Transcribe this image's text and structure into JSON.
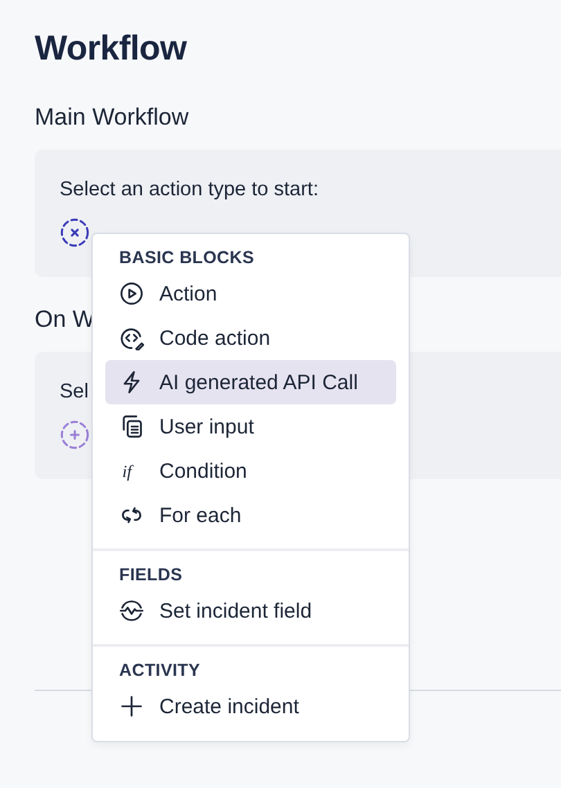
{
  "title": "Workflow",
  "sections": [
    {
      "heading": "Main Workflow",
      "prompt": "Select an action type to start:",
      "picker_open": true
    },
    {
      "heading": "On W",
      "prompt": "Sel",
      "picker_open": false
    }
  ],
  "menu": {
    "groups": [
      {
        "heading": "BASIC BLOCKS",
        "items": [
          {
            "kind": "action",
            "label": "Action",
            "selected": false
          },
          {
            "kind": "code",
            "label": "Code action",
            "selected": false
          },
          {
            "kind": "ai",
            "label": "AI generated API Call",
            "selected": true
          },
          {
            "kind": "input",
            "label": "User input",
            "selected": false
          },
          {
            "kind": "condition",
            "glyph": "if",
            "label": "Condition",
            "selected": false
          },
          {
            "kind": "loop",
            "label": "For each",
            "selected": false
          }
        ]
      },
      {
        "heading": "FIELDS",
        "items": [
          {
            "kind": "field",
            "label": "Set incident field",
            "selected": false
          }
        ]
      },
      {
        "heading": "ACTIVITY",
        "items": [
          {
            "kind": "create",
            "label": "Create incident",
            "selected": false
          }
        ]
      }
    ]
  }
}
